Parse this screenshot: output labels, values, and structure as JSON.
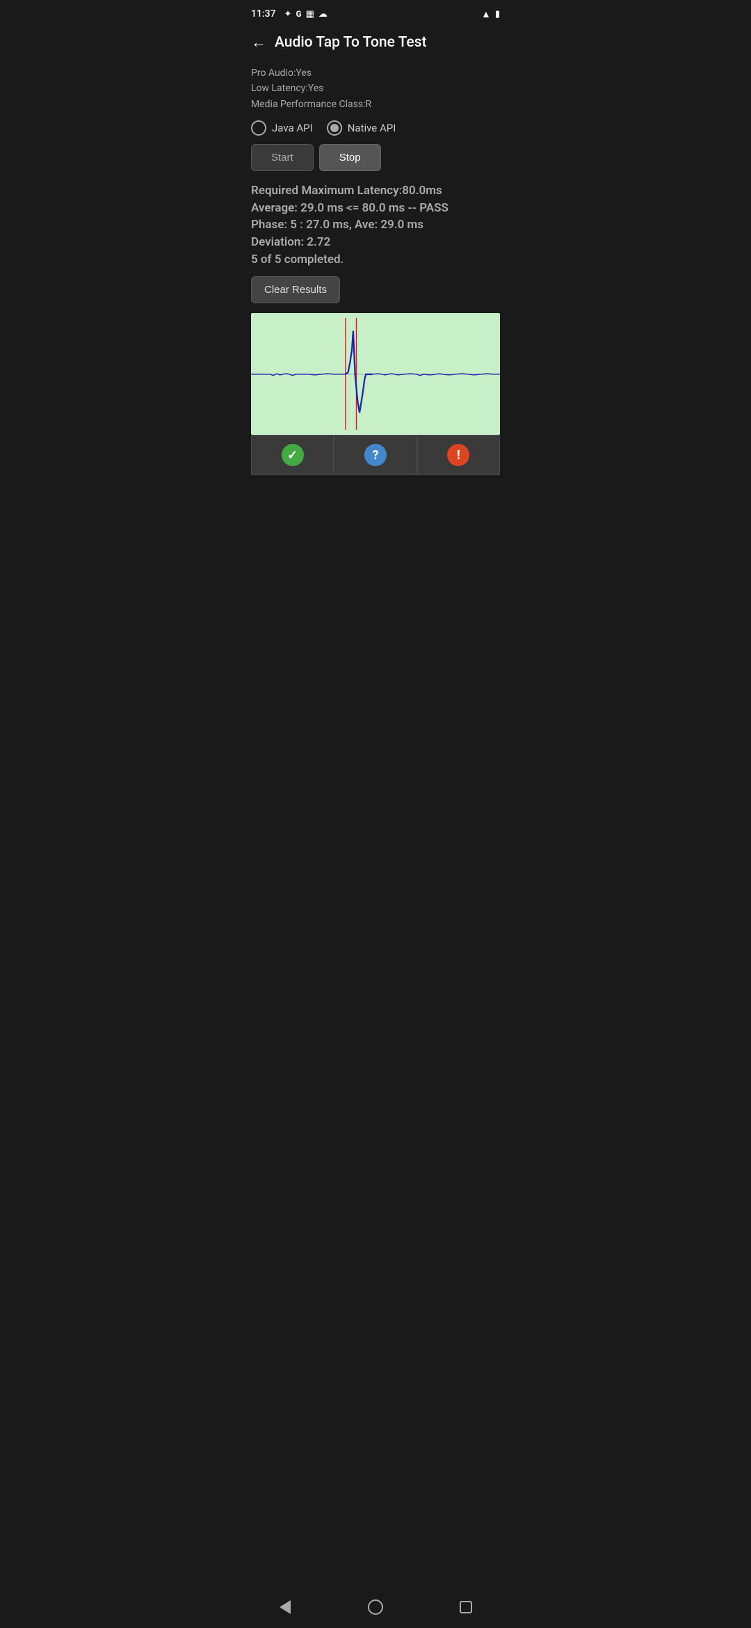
{
  "statusBar": {
    "time": "11:37",
    "icons_left": [
      "fan-icon",
      "google-icon",
      "calendar-icon",
      "cloud-icon"
    ],
    "icons_right": [
      "wifi-icon",
      "battery-icon"
    ]
  },
  "header": {
    "back_label": "←",
    "title": "Audio Tap To Tone Test"
  },
  "deviceInfo": {
    "pro_audio": "Pro Audio:Yes",
    "low_latency": "Low Latency:Yes",
    "media_class": "Media Performance Class:R"
  },
  "apiSelector": {
    "java_api_label": "Java API",
    "native_api_label": "Native API",
    "selected": "native"
  },
  "controls": {
    "start_label": "Start",
    "stop_label": "Stop"
  },
  "results": {
    "line1": "Required Maximum Latency:80.0ms",
    "line2": "Average: 29.0 ms <= 80.0 ms -- PASS",
    "line3": "Phase: 5 : 27.0 ms, Ave: 29.0 ms",
    "line4": "Deviation: 2.72",
    "line5": "5 of 5 completed."
  },
  "clearButton": {
    "label": "Clear Results"
  },
  "waveform": {
    "background_color": "#c8f0c8",
    "line_color": "#2222aa",
    "marker_color": "#cc2222"
  },
  "actionButtons": {
    "pass_icon": "✓",
    "help_icon": "?",
    "warning_icon": "!"
  },
  "bottomNav": {
    "back": "back",
    "home": "home",
    "recent": "recent"
  }
}
